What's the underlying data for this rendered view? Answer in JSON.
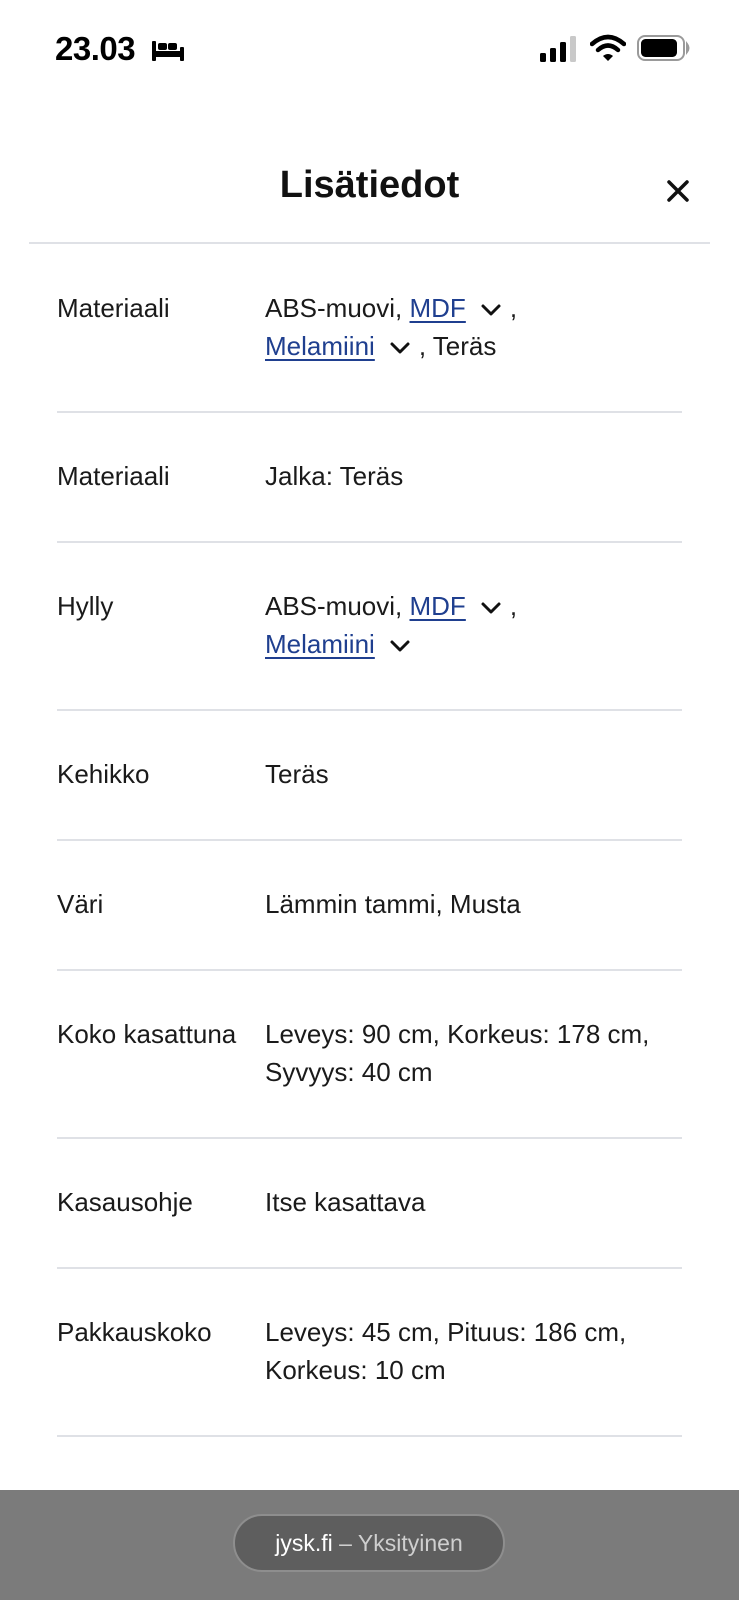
{
  "status_bar": {
    "time": "23.03",
    "focus_icon": "bed-icon",
    "signal_icon": "cellular-signal-icon",
    "wifi_icon": "wifi-icon",
    "battery_icon": "battery-icon"
  },
  "header": {
    "title": "Lisätiedot",
    "close_icon": "close-icon"
  },
  "specs": [
    {
      "label": "Materiaali",
      "value_prefix": "ABS-muovi, ",
      "link1": "MDF",
      "link2": "Melamiini",
      "separator": ",",
      "value_suffix": ", Teräs"
    },
    {
      "label": "Materiaali",
      "value": "Jalka: Teräs"
    },
    {
      "label": "Hylly",
      "value_prefix": "ABS-muovi, ",
      "link1": "MDF",
      "link2": "Melamiini",
      "separator": ","
    },
    {
      "label": "Kehikko",
      "value": "Teräs"
    },
    {
      "label": "Väri",
      "value": "Lämmin tammi, Musta"
    },
    {
      "label": "Koko kasattuna",
      "value": "Leveys: 90 cm, Korkeus: 178 cm, Syvyys: 40 cm"
    },
    {
      "label": "Kasausohje",
      "value": "Itse kasattava"
    },
    {
      "label": "Pakkauskoko",
      "value": "Leveys: 45 cm, Pituus: 186 cm, Korkeus: 10 cm"
    }
  ],
  "browser_bar": {
    "domain": "jysk.fi",
    "separator": " – ",
    "mode": "Yksityinen"
  },
  "colors": {
    "link": "#1f3f8f",
    "divider": "#dfe1e6",
    "bottom_bar": "#7b7b7b"
  }
}
